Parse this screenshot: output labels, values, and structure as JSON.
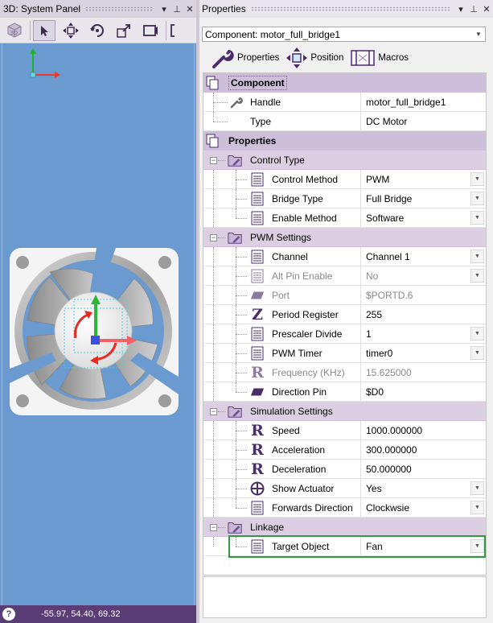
{
  "system_panel": {
    "title": "3D: System Panel",
    "status_coords": "-55.97, 54.40, 69.32",
    "status_help": "?"
  },
  "properties_panel": {
    "title": "Properties",
    "component_select": "Component: motor_full_bridge1",
    "tabs": [
      {
        "label": "Properties",
        "icon": "wrench-icon"
      },
      {
        "label": "Position",
        "icon": "move-arrows-icon"
      },
      {
        "label": "Macros",
        "icon": "macro-icon"
      }
    ],
    "component_section": "Component",
    "component_rows": [
      {
        "name": "Handle",
        "value": "motor_full_bridge1"
      },
      {
        "name": "Type",
        "value": "DC Motor"
      }
    ],
    "properties_section": "Properties",
    "groups": {
      "control_type": {
        "label": "Control Type",
        "rows": [
          {
            "name": "Control Method",
            "value": "PWM"
          },
          {
            "name": "Bridge Type",
            "value": "Full Bridge"
          },
          {
            "name": "Enable Method",
            "value": "Software"
          }
        ]
      },
      "pwm_settings": {
        "label": "PWM Settings",
        "rows": [
          {
            "name": "Channel",
            "value": "Channel 1"
          },
          {
            "name": "Alt Pin Enable",
            "value": "No"
          },
          {
            "name": "Port",
            "value": "$PORTD.6"
          },
          {
            "name": "Period Register",
            "value": "255"
          },
          {
            "name": "Prescaler Divide",
            "value": "1"
          },
          {
            "name": "PWM Timer",
            "value": "timer0"
          },
          {
            "name": "Frequency (KHz)",
            "value": "15.625000"
          },
          {
            "name": "Direction Pin",
            "value": "$D0"
          }
        ]
      },
      "simulation_settings": {
        "label": "Simulation Settings",
        "rows": [
          {
            "name": "Speed",
            "value": "1000.000000"
          },
          {
            "name": "Acceleration",
            "value": "300.000000"
          },
          {
            "name": "Deceleration",
            "value": "50.000000"
          },
          {
            "name": "Show Actuator",
            "value": "Yes"
          },
          {
            "name": "Forwards Direction",
            "value": "Clockwsie"
          }
        ]
      },
      "linkage": {
        "label": "Linkage",
        "rows": [
          {
            "name": "Target Object",
            "value": "Fan"
          }
        ]
      }
    }
  },
  "colors": {
    "viewport_bg": "#6a9ad0",
    "section_bg": "#dccfe3",
    "accent_purple": "#5a3d74",
    "highlight_green": "#2f9a3f"
  }
}
